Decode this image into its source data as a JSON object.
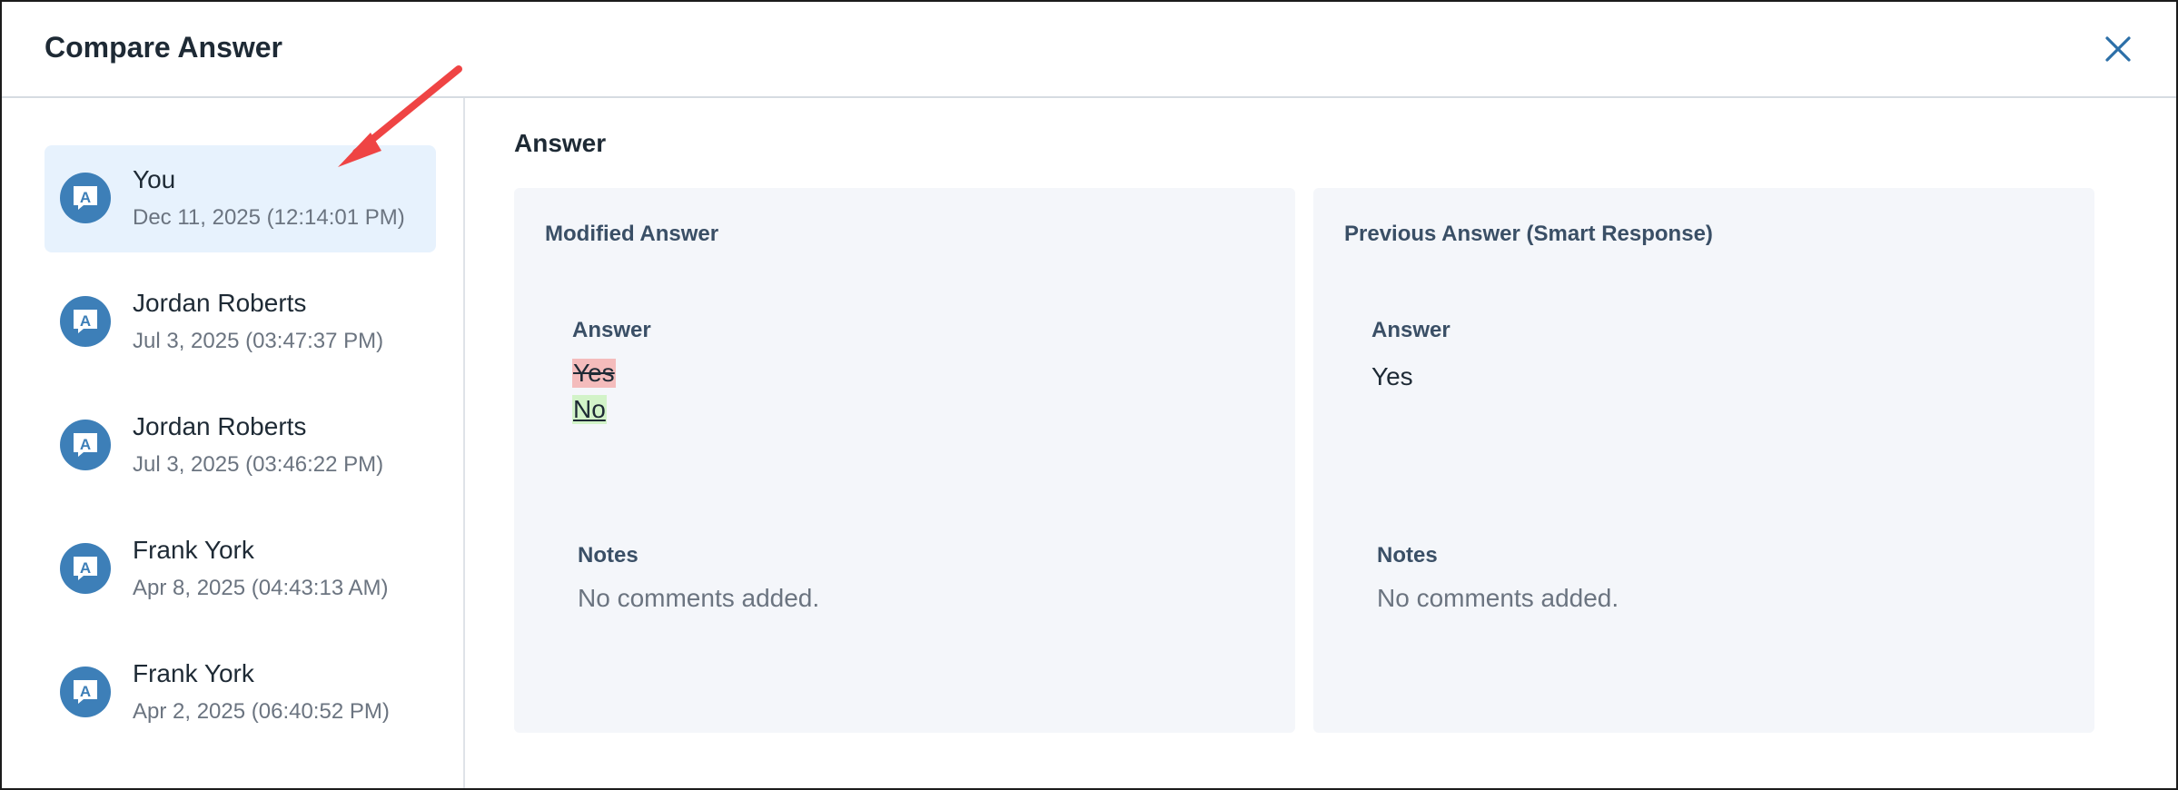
{
  "dialog": {
    "title": "Compare Answer",
    "close_icon": "close-icon"
  },
  "sidebar": {
    "items": [
      {
        "name": "You",
        "date": "Dec 11, 2025 (12:14:01 PM)",
        "active": true,
        "icon": "response-avatar-icon"
      },
      {
        "name": "Jordan Roberts",
        "date": "Jul 3, 2025 (03:47:37 PM)",
        "active": false,
        "icon": "response-avatar-icon"
      },
      {
        "name": "Jordan Roberts",
        "date": "Jul 3, 2025 (03:46:22 PM)",
        "active": false,
        "icon": "response-avatar-icon"
      },
      {
        "name": "Frank York",
        "date": "Apr 8, 2025 (04:43:13 AM)",
        "active": false,
        "icon": "response-avatar-icon"
      },
      {
        "name": "Frank York",
        "date": "Apr 2, 2025 (06:40:52 PM)",
        "active": false,
        "icon": "response-avatar-icon"
      }
    ]
  },
  "main": {
    "heading": "Answer",
    "modified": {
      "title": "Modified Answer",
      "answer_label": "Answer",
      "removed_value": "Yes",
      "added_value": "No",
      "notes_label": "Notes",
      "notes_text": "No comments added."
    },
    "previous": {
      "title": "Previous Answer (Smart Response)",
      "answer_label": "Answer",
      "value": "Yes",
      "notes_label": "Notes",
      "notes_text": "No comments added."
    }
  },
  "colors": {
    "accent": "#3d7fb8",
    "active_item_bg": "#e7f2fd",
    "removed_bg": "#f4bcbc",
    "added_bg": "#d2f3c8",
    "annotation_arrow": "#ef4444"
  }
}
